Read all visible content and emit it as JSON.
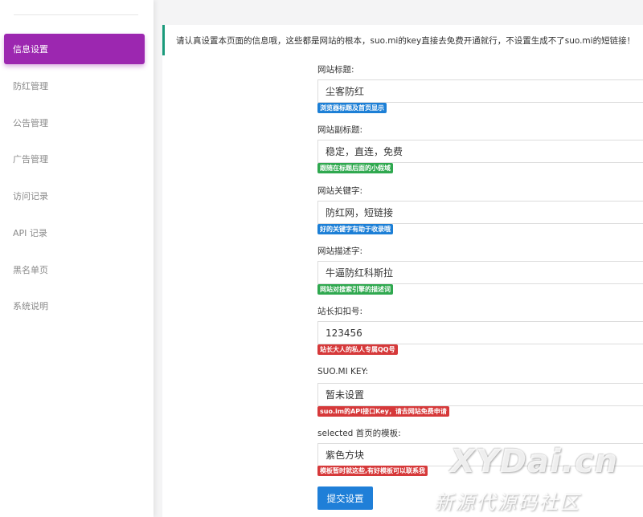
{
  "sidebar": {
    "items": [
      {
        "label": "信息设置",
        "active": true
      },
      {
        "label": "防红管理",
        "active": false
      },
      {
        "label": "公告管理",
        "active": false
      },
      {
        "label": "广告管理",
        "active": false
      },
      {
        "label": "访问记录",
        "active": false
      },
      {
        "label": "API 记录",
        "active": false
      },
      {
        "label": "黑名单页",
        "active": false
      },
      {
        "label": "系统说明",
        "active": false
      }
    ]
  },
  "notice": {
    "text": "请认真设置本页面的信息哦，这些都是网站的根本，suo.mi的key直接去免费开通就行，不设置生成不了suo.mi的短链接！"
  },
  "form": {
    "fields": [
      {
        "label": "网站标题:",
        "value": "尘客防红",
        "hint": "浏览器标题及首页显示",
        "hint_color": "#1c7fd6"
      },
      {
        "label": "网站副标题:",
        "value": "稳定，直连，免费",
        "hint": "跟随在标题后面的小假域",
        "hint_color": "#2fa84f"
      },
      {
        "label": "网站关键字:",
        "value": "防红网，短链接",
        "hint": "好的关键字有助于收录哦",
        "hint_color": "#1c7fd6"
      },
      {
        "label": "网站描述字:",
        "value": "牛逼防红科斯拉",
        "hint": "网站对搜索引擎的描述词",
        "hint_color": "#2fa84f"
      },
      {
        "label": "站长扣扣号:",
        "value": "123456",
        "hint": "站长大人的私人专属QQ号",
        "hint_color": "#d6393a"
      },
      {
        "label": "SUO.MI KEY:",
        "value": "暂未设置",
        "hint": "suo.im的API接口Key，请去网站免费申请",
        "hint_color": "#d6393a"
      },
      {
        "label": "selected 首页的模板:",
        "value": "紫色方块",
        "hint": "模板暂时就这些,有好模板可以联系我",
        "hint_color": "#d6393a"
      }
    ],
    "submit_label": "提交设置"
  },
  "watermark": {
    "brand": "XYDai.cn",
    "tagline": "新源代源码社区"
  },
  "colors": {
    "accent": "#9c27b0",
    "primary": "#1f7fd8",
    "notice_border": "#1a9a7b"
  }
}
